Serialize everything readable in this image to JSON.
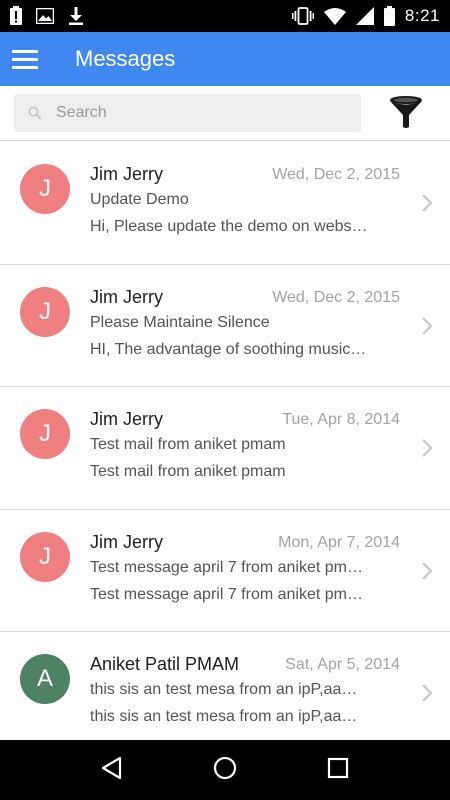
{
  "status_bar": {
    "time": "8:21",
    "left_icons": [
      "alert-icon",
      "image-icon",
      "download-icon"
    ],
    "right_icons": [
      "vibrate-icon",
      "wifi-icon",
      "signal-icon",
      "battery-icon"
    ]
  },
  "app_bar": {
    "title": "Messages",
    "color": "#3f88f0"
  },
  "search": {
    "placeholder": "Search",
    "value": ""
  },
  "messages": [
    {
      "avatar_letter": "J",
      "avatar_color": "#f08080",
      "sender": "Jim Jerry",
      "date": "Wed, Dec 2, 2015",
      "subject": "Update Demo",
      "preview": "Hi, Please update the demo on webs…"
    },
    {
      "avatar_letter": "J",
      "avatar_color": "#f08080",
      "sender": "Jim Jerry",
      "date": "Wed, Dec 2, 2015",
      "subject": "Please Maintaine Silence",
      "preview": "HI, The advantage of soothing music…"
    },
    {
      "avatar_letter": "J",
      "avatar_color": "#f08080",
      "sender": "Jim Jerry",
      "date": "Tue, Apr 8, 2014",
      "subject": "Test mail from aniket pmam",
      "preview": "Test mail from aniket pmam"
    },
    {
      "avatar_letter": "J",
      "avatar_color": "#f08080",
      "sender": "Jim Jerry",
      "date": "Mon, Apr 7, 2014",
      "subject": "Test message april 7 from aniket pm…",
      "preview": "Test message april 7 from aniket pm…"
    },
    {
      "avatar_letter": "A",
      "avatar_color": "#4e8264",
      "sender": "Aniket Patil PMAM",
      "date": "Sat, Apr 5, 2014",
      "subject": "this sis an test mesa from an ipP,aa…",
      "preview": "this sis an test mesa from an ipP,aa…"
    }
  ],
  "nav_bar": {
    "buttons": [
      "back-icon",
      "home-icon",
      "recents-icon"
    ]
  }
}
